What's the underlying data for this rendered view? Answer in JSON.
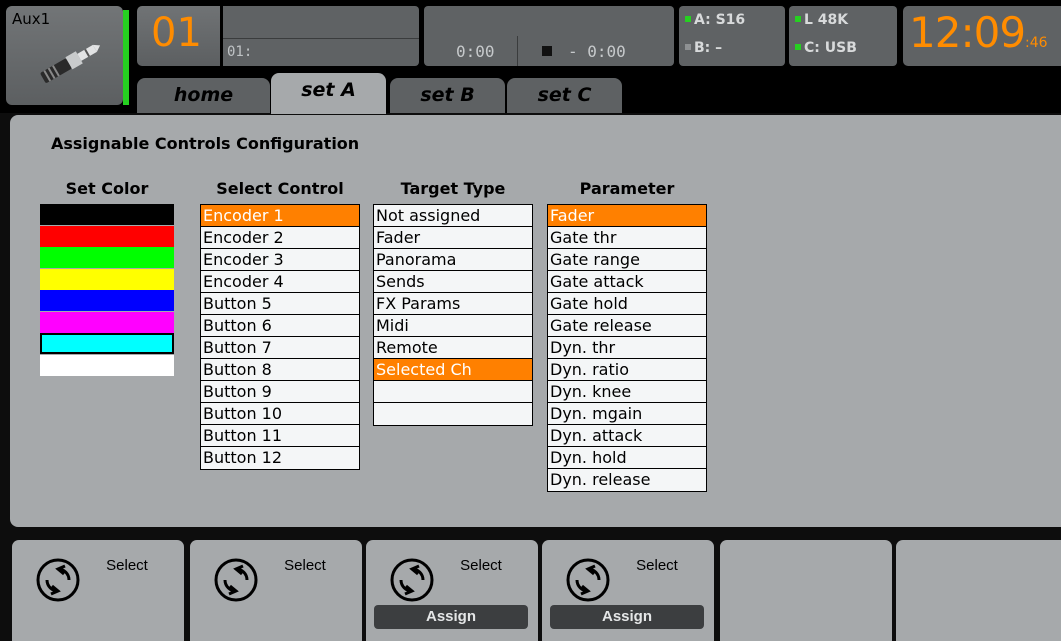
{
  "header": {
    "channel_name": "Aux1",
    "channel_number": "01",
    "scene_name": "01:",
    "player": {
      "time_elapsed": "0:00",
      "time_remaining": "- 0:00"
    },
    "routing": {
      "a": "A: S16",
      "b": "B:  –",
      "l": "L   48K",
      "c": "C: USB"
    },
    "clock": {
      "time": "12:09",
      "seconds": ":46"
    },
    "tabs": [
      "home",
      "set A",
      "set B",
      "set C"
    ],
    "active_tab": "set A"
  },
  "main": {
    "heading": "Assignable Controls Configuration",
    "set_color": {
      "header": "Set Color",
      "swatches": [
        "#000000",
        "#ff0000",
        "#00ff00",
        "#ffff00",
        "#0000ff",
        "#ff00ff",
        "#00ffff",
        "#ffffff"
      ],
      "selected_index": 6
    },
    "select_control": {
      "header": "Select Control",
      "items": [
        "Encoder 1",
        "Encoder 2",
        "Encoder 3",
        "Encoder 4",
        "Button 5",
        "Button 6",
        "Button 7",
        "Button 8",
        "Button 9",
        "Button 10",
        "Button 11",
        "Button 12"
      ],
      "selected_index": 0
    },
    "target_type": {
      "header": "Target Type",
      "items": [
        "Not assigned",
        "Fader",
        "Panorama",
        "Sends",
        "FX Params",
        "Midi",
        "Remote",
        "Selected Ch",
        "",
        ""
      ],
      "selected_index": 7
    },
    "parameter": {
      "header": "Parameter",
      "items": [
        "Fader",
        "Gate thr",
        "Gate range",
        "Gate attack",
        "Gate hold",
        "Gate release",
        "Dyn. thr",
        "Dyn. ratio",
        "Dyn. knee",
        "Dyn. mgain",
        "Dyn. attack",
        "Dyn. hold",
        "Dyn. release"
      ],
      "selected_index": 0
    }
  },
  "bottom": {
    "buttons": [
      {
        "label": "Select",
        "icon": "rotate-encoder-icon",
        "sub": ""
      },
      {
        "label": "Select",
        "icon": "rotate-encoder-icon",
        "sub": ""
      },
      {
        "label": "Select",
        "icon": "rotate-encoder-icon",
        "sub": "Assign"
      },
      {
        "label": "Select",
        "icon": "rotate-encoder-icon",
        "sub": "Assign"
      },
      {
        "label": "",
        "icon": "",
        "sub": ""
      },
      {
        "label": "",
        "icon": "",
        "sub": ""
      }
    ]
  },
  "colors": {
    "accent": "#ff8000",
    "led_green": "#26d021",
    "panel": "#a6a9ab"
  }
}
